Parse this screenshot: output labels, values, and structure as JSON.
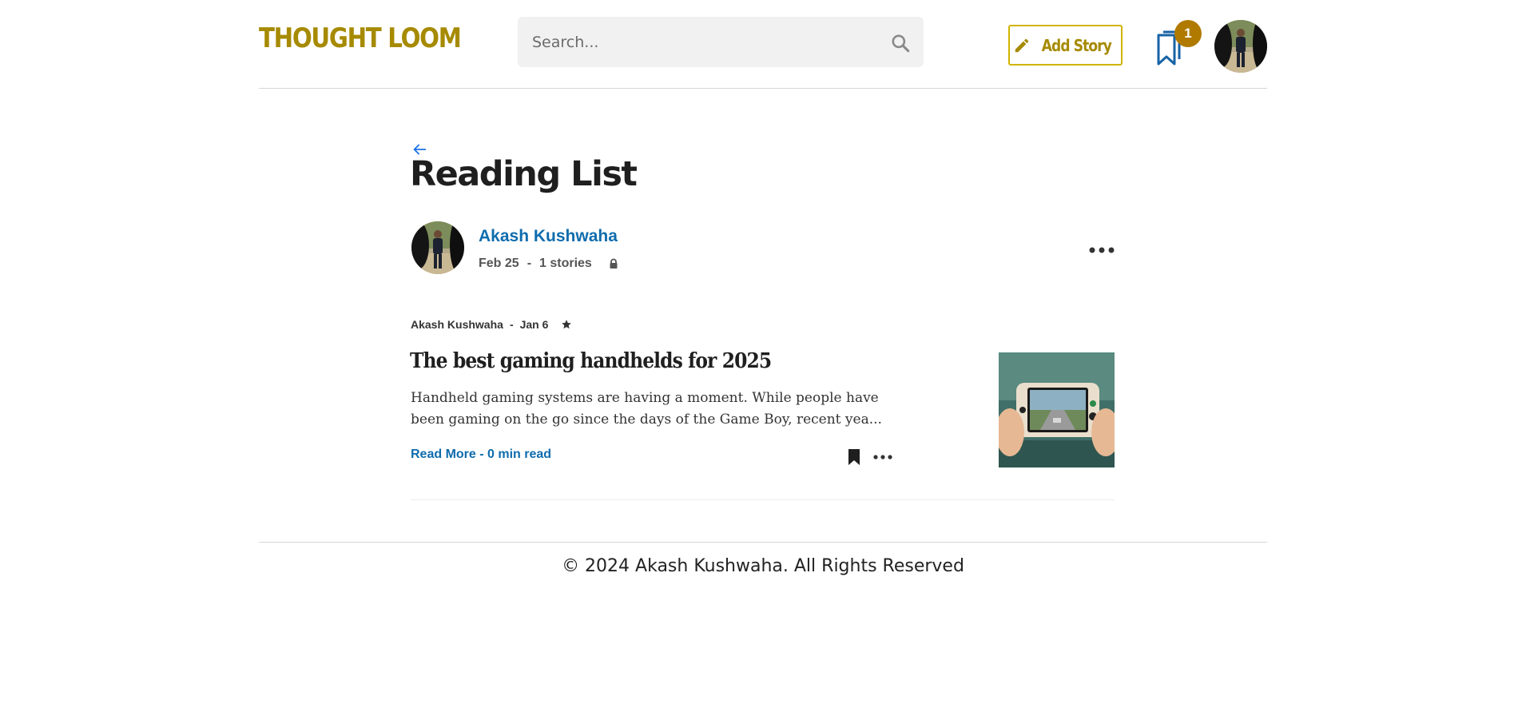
{
  "header": {
    "logo": "THOUGHT LOOM",
    "search_placeholder": "Search...",
    "add_story_label": "Add Story",
    "bookmark_count": "1"
  },
  "page": {
    "title": "Reading List"
  },
  "list": {
    "author_name": "Akash Kushwaha",
    "date": "Feb 25",
    "separator": "-",
    "story_count": "1 stories"
  },
  "stories": [
    {
      "author": "Akash Kushwaha",
      "separator": "-",
      "date": "Jan 6",
      "title": "The best gaming handhelds for 2025",
      "excerpt": "Handheld gaming systems are having a moment. While people have been gaming on the go since the days of the Game Boy, recent yea...",
      "read_more": "Read More - 0 min read"
    }
  ],
  "footer": {
    "copyright": "© 2024 Akash Kushwaha. All Rights Reserved"
  },
  "icons": {
    "search": "search-icon",
    "add_story": "pencil-icon",
    "bookmarks": "bookmarks-icon",
    "back": "arrow-left-icon",
    "lock": "lock-icon",
    "star": "star-icon",
    "more": "more-horizontal-icon",
    "bookmark_filled": "bookmark-filled-icon"
  },
  "colors": {
    "brand": "#a68a00",
    "accent_border": "#d0b400",
    "badge": "#b07a00",
    "link": "#0f6cad",
    "back_arrow": "#1a73e8"
  }
}
